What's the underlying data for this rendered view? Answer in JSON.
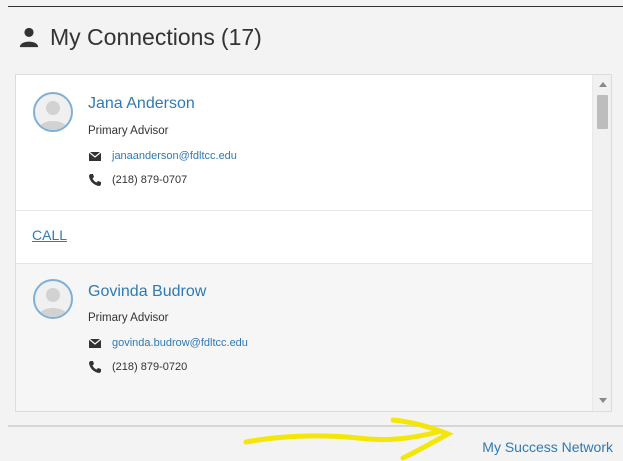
{
  "header": {
    "title": "My Connections",
    "count": "(17)",
    "icon": "person-icon"
  },
  "connections": [
    {
      "name": "Jana Anderson",
      "role": "Primary Advisor",
      "email": "janaanderson@fdltcc.edu",
      "phone": "(218) 879-0707"
    },
    {
      "name": "Govinda Budrow",
      "role": "Primary Advisor",
      "email": "govinda.budrow@fdltcc.edu",
      "phone": "(218) 879-0720"
    }
  ],
  "call_label": "CALL",
  "footer": {
    "link_label": "My Success Network"
  },
  "colors": {
    "link": "#2f7ab3",
    "annotation": "#f5e60a",
    "avatar_border": "#7fb0d6"
  }
}
